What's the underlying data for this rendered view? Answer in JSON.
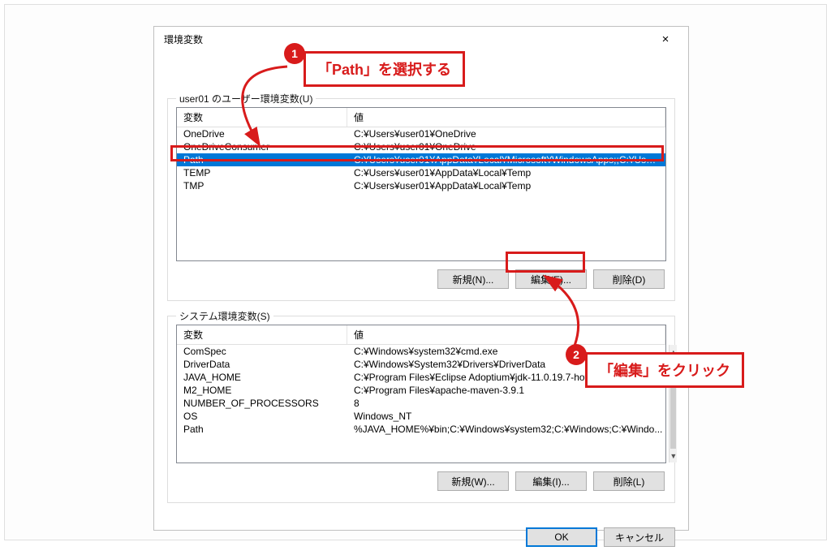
{
  "title": "環境変数",
  "close_icon": "×",
  "user_group_label": "user01 のユーザー環境変数(U)",
  "sys_group_label": "システム環境変数(S)",
  "col_variable": "変数",
  "col_value": "値",
  "user_vars": [
    {
      "name": "OneDrive",
      "value": "C:¥Users¥user01¥OneDrive"
    },
    {
      "name": "OneDriveConsumer",
      "value": "C:¥Users¥user01¥OneDrive"
    },
    {
      "name": "Path",
      "value": "C:¥Users¥user01¥AppData¥Local¥Microsoft¥WindowsApps;;C:¥User..."
    },
    {
      "name": "TEMP",
      "value": "C:¥Users¥user01¥AppData¥Local¥Temp"
    },
    {
      "name": "TMP",
      "value": "C:¥Users¥user01¥AppData¥Local¥Temp"
    }
  ],
  "user_selected_index": 2,
  "sys_vars": [
    {
      "name": "ComSpec",
      "value": "C:¥Windows¥system32¥cmd.exe"
    },
    {
      "name": "DriverData",
      "value": "C:¥Windows¥System32¥Drivers¥DriverData"
    },
    {
      "name": "JAVA_HOME",
      "value": "C:¥Program Files¥Eclipse Adoptium¥jdk-11.0.19.7-hotspot¥"
    },
    {
      "name": "M2_HOME",
      "value": "C:¥Program Files¥apache-maven-3.9.1"
    },
    {
      "name": "NUMBER_OF_PROCESSORS",
      "value": "8"
    },
    {
      "name": "OS",
      "value": "Windows_NT"
    },
    {
      "name": "Path",
      "value": "%JAVA_HOME%¥bin;C:¥Windows¥system32;C:¥Windows;C:¥Windo..."
    }
  ],
  "user_buttons": {
    "new": "新規(N)...",
    "edit": "編集(E)...",
    "delete": "削除(D)"
  },
  "sys_buttons": {
    "new": "新規(W)...",
    "edit": "編集(I)...",
    "delete": "削除(L)"
  },
  "footer": {
    "ok": "OK",
    "cancel": "キャンセル"
  },
  "annotations": {
    "step1_number": "1",
    "step1_text": "「Path」を選択する",
    "step2_number": "2",
    "step2_text": "「編集」をクリック"
  }
}
